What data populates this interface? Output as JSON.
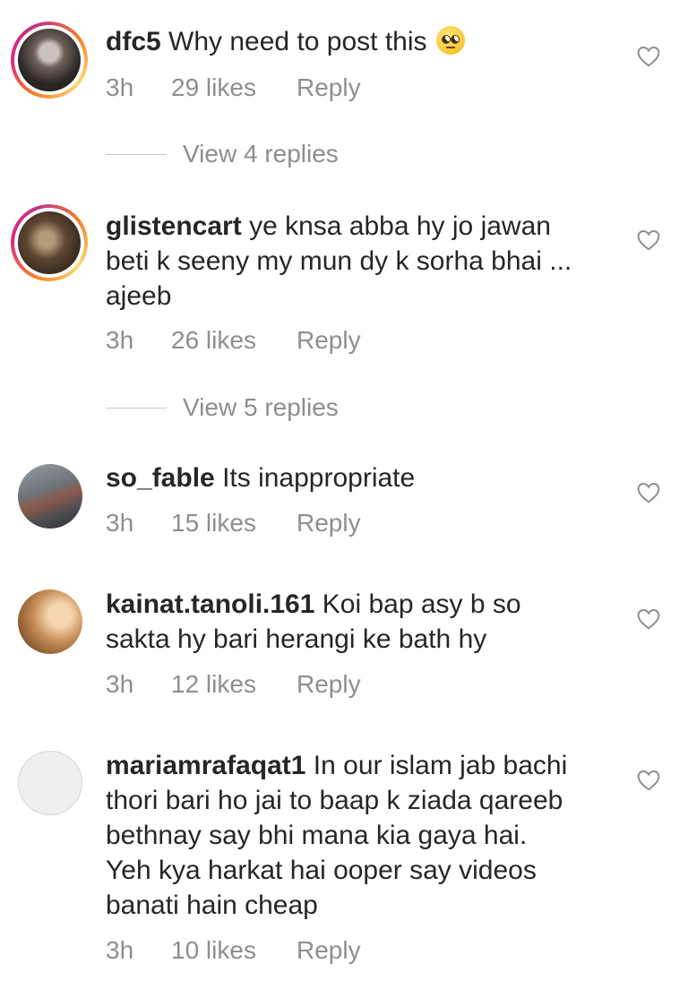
{
  "comments": [
    {
      "username": "dfc5",
      "text": "Why need to post this",
      "emoji_icon": "face-with-rolling-eyes-emoji",
      "time": "3h",
      "likes": "29 likes",
      "reply": "Reply",
      "view_replies": "View 4 replies"
    },
    {
      "username": "glistencart",
      "text_lines": [
        "ye knsa abba hy jo jawan",
        "beti k seeny my mun dy k sorha bhai ...",
        "ajeeb"
      ],
      "time": "3h",
      "likes": "26 likes",
      "reply": "Reply",
      "view_replies": "View 5 replies"
    },
    {
      "username": "so_fable",
      "text": "Its inappropriate",
      "time": "3h",
      "likes": "15 likes",
      "reply": "Reply"
    },
    {
      "username": "kainat.tanoli.161",
      "text_lines": [
        "Koi bap asy b so",
        "sakta hy bari herangi ke bath hy"
      ],
      "time": "3h",
      "likes": "12 likes",
      "reply": "Reply"
    },
    {
      "username": "mariamrafaqat1",
      "text_lines": [
        "In our islam jab bachi",
        "thori bari ho jai to baap k ziada qareeb",
        "bethnay say bhi mana kia gaya hai.",
        "Yeh kya harkat hai ooper say videos",
        "banati hain cheap"
      ],
      "time": "3h",
      "likes": "10 likes",
      "reply": "Reply"
    }
  ],
  "colors": {
    "text": "#262626",
    "meta": "#8e8e8e",
    "ring": "#dd2a7b"
  }
}
